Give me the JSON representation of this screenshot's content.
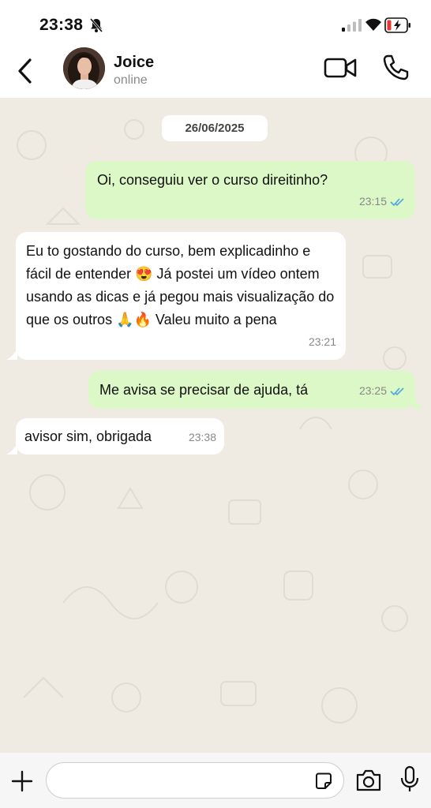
{
  "status_bar": {
    "time": "23:38",
    "icons": [
      "bell-slash-icon",
      "signal-icon",
      "wifi-icon",
      "battery-charging-icon"
    ]
  },
  "header": {
    "name": "Joice",
    "status": "online",
    "icons": [
      "back-arrow-icon",
      "video-call-icon",
      "phone-call-icon"
    ]
  },
  "chat": {
    "date": "26/06/2025",
    "messages": [
      {
        "direction": "outgoing",
        "text": "Oi, conseguiu ver o curso direitinho?",
        "time": "23:15",
        "read": true
      },
      {
        "direction": "incoming",
        "text": "Eu to gostando do curso, bem explicadinho e fácil de entender 😍 Já postei um vídeo ontem usando as dicas e já pegou mais visualização do que os outros 🙏🔥 Valeu muito a pena",
        "time": "23:21"
      },
      {
        "direction": "outgoing",
        "text": "Me avisa se precisar de ajuda, tá",
        "time": "23:25",
        "read": true
      },
      {
        "direction": "incoming",
        "text": "avisor sim, obrigada",
        "time": "23:38"
      }
    ]
  },
  "input_bar": {
    "placeholder": "",
    "value": "",
    "icons": [
      "plus-icon",
      "sticker-icon",
      "camera-icon",
      "microphone-icon"
    ]
  },
  "colors": {
    "outgoing_bubble": "#dcf8c6",
    "incoming_bubble": "#ffffff",
    "chat_background": "#efeae2",
    "read_ticks": "#4fa3e0"
  }
}
